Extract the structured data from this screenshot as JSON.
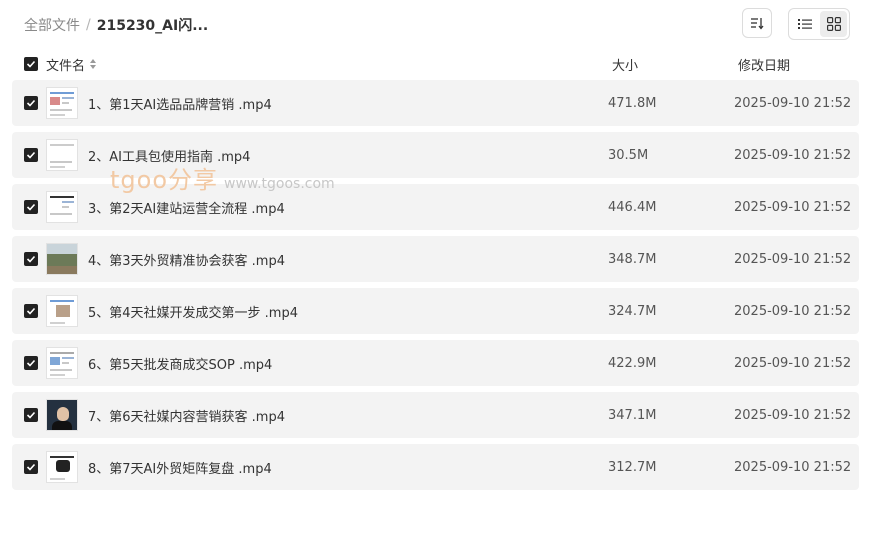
{
  "breadcrumb": {
    "root": "全部文件",
    "separator": "/",
    "current": "215230_AI闪..."
  },
  "toolbar": {
    "sort_icon": "sort-icon",
    "list_view_icon": "list-view-icon",
    "grid_view_icon": "grid-view-icon",
    "active_view": "list"
  },
  "header": {
    "name": "文件名",
    "size": "大小",
    "date": "修改日期"
  },
  "files": [
    {
      "name": "1、第1天AI选品品牌营销 .mp4",
      "size": "471.8M",
      "date": "2025-09-10 21:52"
    },
    {
      "name": "2、AI工具包使用指南 .mp4",
      "size": "30.5M",
      "date": "2025-09-10 21:52"
    },
    {
      "name": "3、第2天AI建站运营全流程 .mp4",
      "size": "446.4M",
      "date": "2025-09-10 21:52"
    },
    {
      "name": "4、第3天外贸精准协会获客 .mp4",
      "size": "348.7M",
      "date": "2025-09-10 21:52"
    },
    {
      "name": "5、第4天社媒开发成交第一步 .mp4",
      "size": "324.7M",
      "date": "2025-09-10 21:52"
    },
    {
      "name": "6、第5天批发商成交SOP .mp4",
      "size": "422.9M",
      "date": "2025-09-10 21:52"
    },
    {
      "name": "7、第6天社媒内容营销获客 .mp4",
      "size": "347.1M",
      "date": "2025-09-10 21:52"
    },
    {
      "name": "8、第7天AI外贸矩阵复盘 .mp4",
      "size": "312.7M",
      "date": "2025-09-10 21:52"
    }
  ],
  "watermark": {
    "brand": "tgoo分享",
    "url": "www.tgoos.com"
  },
  "colors": {
    "row_bg": "#f3f3f3",
    "checkbox": "#222222",
    "watermark": "#f2c9a4"
  }
}
